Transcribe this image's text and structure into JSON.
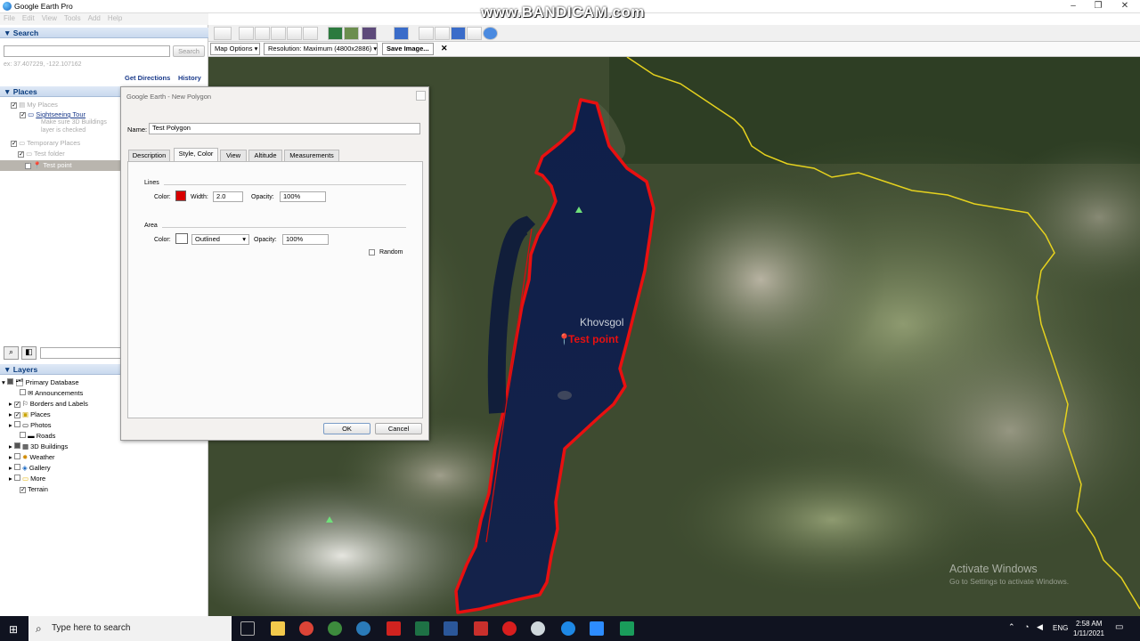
{
  "app": {
    "title": "Google Earth Pro",
    "watermark": "www.BANDICAM.com"
  },
  "menu": [
    "File",
    "Edit",
    "View",
    "Tools",
    "Add",
    "Help"
  ],
  "search": {
    "header": "Search",
    "button": "Search",
    "coords": "ex: 37.407229, -122.107162",
    "get_directions": "Get Directions",
    "history": "History"
  },
  "places": {
    "header": "Places",
    "items": [
      {
        "label": "My Places",
        "style": "gray"
      },
      {
        "label": "Sightseeing Tour",
        "style": "link"
      },
      {
        "label": "Make sure 3D Buildings",
        "style": "gray"
      },
      {
        "label": "layer is checked",
        "style": "gray"
      },
      {
        "label": "Temporary Places",
        "style": "gray"
      },
      {
        "label": "Test folder",
        "style": "gray"
      },
      {
        "label": "Test point",
        "style": "selected"
      }
    ]
  },
  "layers": {
    "header": "Layers",
    "items": [
      "Primary Database",
      "Announcements",
      "Borders and Labels",
      "Places",
      "Photos",
      "Roads",
      "3D Buildings",
      "Weather",
      "Gallery",
      "More",
      "Terrain"
    ]
  },
  "toolbar2": {
    "map_options": "Map Options",
    "resolution": "Resolution: Maximum (4800x2886)",
    "save_image": "Save Image...",
    "close": "✕"
  },
  "dialog": {
    "title": "Google Earth - New Polygon",
    "name_label": "Name:",
    "name_value": "Test Polygon",
    "tabs": [
      "Description",
      "Style, Color",
      "View",
      "Altitude",
      "Measurements"
    ],
    "lines": {
      "label": "Lines",
      "color_label": "Color:",
      "color": "#d80000",
      "width_label": "Width:",
      "width": "2.0",
      "opacity_label": "Opacity:",
      "opacity": "100%"
    },
    "area": {
      "label": "Area",
      "color_label": "Color:",
      "fill": "Outlined",
      "opacity_label": "Opacity:",
      "opacity": "100%"
    },
    "random": "Random",
    "ok": "OK",
    "cancel": "Cancel"
  },
  "map": {
    "place_label": "Khovsgol",
    "point_label": "Test point",
    "activate_1": "Activate Windows",
    "activate_2": "Go to Settings to activate Windows.",
    "polygon_color": "#e81010",
    "border_color": "#e6d21e"
  },
  "taskbar": {
    "search_placeholder": "Type here to search",
    "lang": "ENG",
    "time": "2:58 AM",
    "date": "1/11/2021"
  }
}
